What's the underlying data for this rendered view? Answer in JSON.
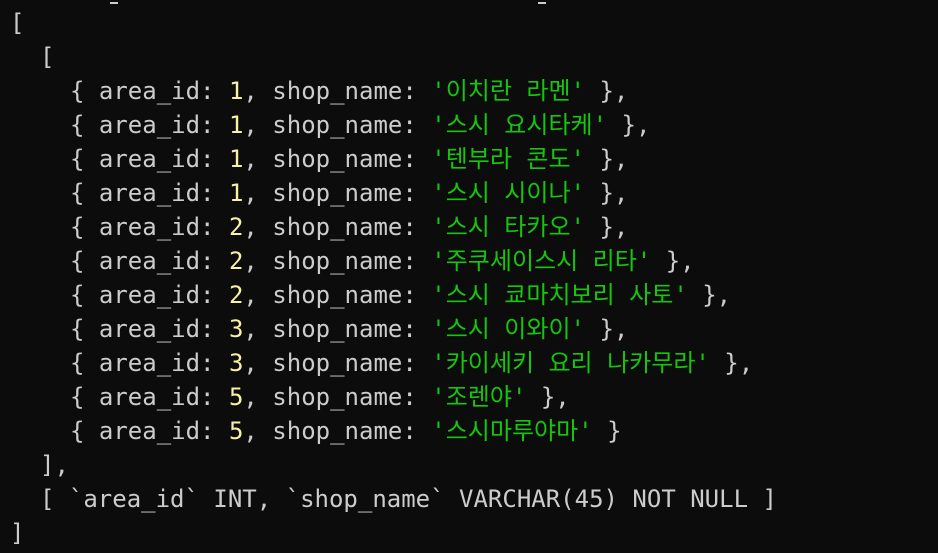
{
  "output": {
    "open_bracket": "[",
    "inner_open_bracket": "[",
    "rows": [
      {
        "area_id": "1",
        "shop_name": "'이치란 라멘'",
        "tail": " },"
      },
      {
        "area_id": "1",
        "shop_name": "'스시 요시타케'",
        "tail": " },"
      },
      {
        "area_id": "1",
        "shop_name": "'텐부라 콘도'",
        "tail": " },"
      },
      {
        "area_id": "1",
        "shop_name": "'스시 시이나'",
        "tail": " },"
      },
      {
        "area_id": "2",
        "shop_name": "'스시 타카오'",
        "tail": " },"
      },
      {
        "area_id": "2",
        "shop_name": "'주쿠세이스시 리타'",
        "tail": " },"
      },
      {
        "area_id": "2",
        "shop_name": "'스시 쿄마치보리 사토'",
        "tail": " },"
      },
      {
        "area_id": "3",
        "shop_name": "'스시 이와이'",
        "tail": " },"
      },
      {
        "area_id": "3",
        "shop_name": "'카이세키 요리 나카무라'",
        "tail": " },"
      },
      {
        "area_id": "5",
        "shop_name": "'조렌야'",
        "tail": " },"
      },
      {
        "area_id": "5",
        "shop_name": "'스시마루야마'",
        "tail": " }"
      }
    ],
    "row_prefix": "{ area_id: ",
    "row_middle": ", shop_name: ",
    "inner_close_bracket": "],",
    "fields_line": "[ `area_id` INT, `shop_name` VARCHAR(45) NOT NULL ]",
    "close_bracket": "]"
  },
  "colors": {
    "background": "#0c0c0c",
    "text": "#cccccc",
    "number": "#f9f1a5",
    "string": "#16c60c"
  }
}
